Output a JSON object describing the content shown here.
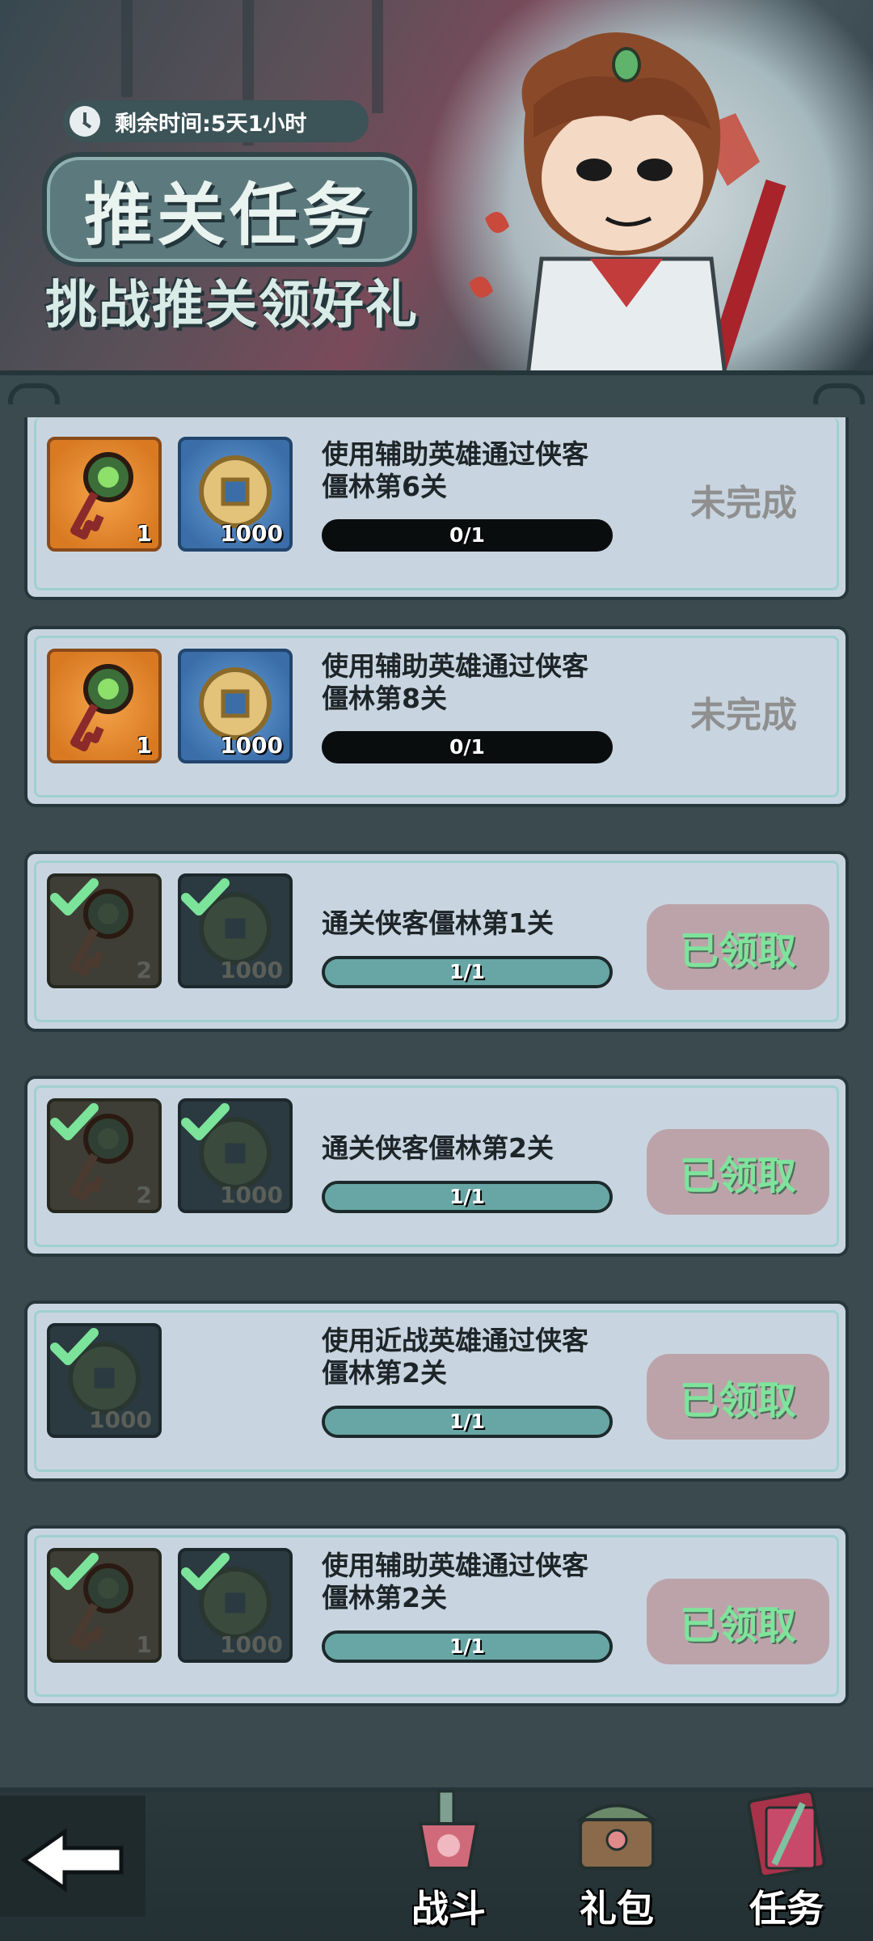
{
  "banner": {
    "timer_label": "剩余时间:5天1小时",
    "title": "推关任务",
    "subtitle": "挑战推关领好礼"
  },
  "tasks": [
    {
      "description": "使用辅助英雄通过侠客僵林第6关",
      "progress": "0/1",
      "progress_fraction": 0,
      "status": "未完成",
      "rewards": [
        {
          "type": "key",
          "qty": "1",
          "claimed": false
        },
        {
          "type": "coin",
          "qty": "1000",
          "claimed": false
        }
      ]
    },
    {
      "description": "使用辅助英雄通过侠客僵林第8关",
      "progress": "0/1",
      "progress_fraction": 0,
      "status": "未完成",
      "rewards": [
        {
          "type": "key",
          "qty": "1",
          "claimed": false
        },
        {
          "type": "coin",
          "qty": "1000",
          "claimed": false
        }
      ]
    },
    {
      "description": "通关侠客僵林第1关",
      "progress": "1/1",
      "progress_fraction": 1,
      "status": "已领取",
      "rewards": [
        {
          "type": "key",
          "qty": "2",
          "claimed": true
        },
        {
          "type": "coin",
          "qty": "1000",
          "claimed": true
        }
      ]
    },
    {
      "description": "通关侠客僵林第2关",
      "progress": "1/1",
      "progress_fraction": 1,
      "status": "已领取",
      "rewards": [
        {
          "type": "key",
          "qty": "2",
          "claimed": true
        },
        {
          "type": "coin",
          "qty": "1000",
          "claimed": true
        }
      ]
    },
    {
      "description": "使用近战英雄通过侠客僵林第2关",
      "progress": "1/1",
      "progress_fraction": 1,
      "status": "已领取",
      "rewards": [
        {
          "type": "coin",
          "qty": "1000",
          "claimed": true
        }
      ]
    },
    {
      "description": "使用辅助英雄通过侠客僵林第2关",
      "progress": "1/1",
      "progress_fraction": 1,
      "status": "已领取",
      "rewards": [
        {
          "type": "key",
          "qty": "1",
          "claimed": true
        },
        {
          "type": "coin",
          "qty": "1000",
          "claimed": true
        }
      ]
    }
  ],
  "nav": {
    "battle": "战斗",
    "gift": "礼包",
    "task": "任务",
    "active": "task"
  },
  "colors": {
    "card_bg": "#c8d5e0",
    "claimed_button": "#bca3aa",
    "claimed_text": "#7fe39c",
    "incomplete_text": "#8f8f8f",
    "progress_fill": "#67a6a4"
  },
  "icons": [
    "clock-icon",
    "key-icon",
    "coin-icon",
    "check-icon",
    "back-arrow-icon",
    "battle-icon",
    "gift-chest-icon",
    "task-scroll-icon"
  ]
}
